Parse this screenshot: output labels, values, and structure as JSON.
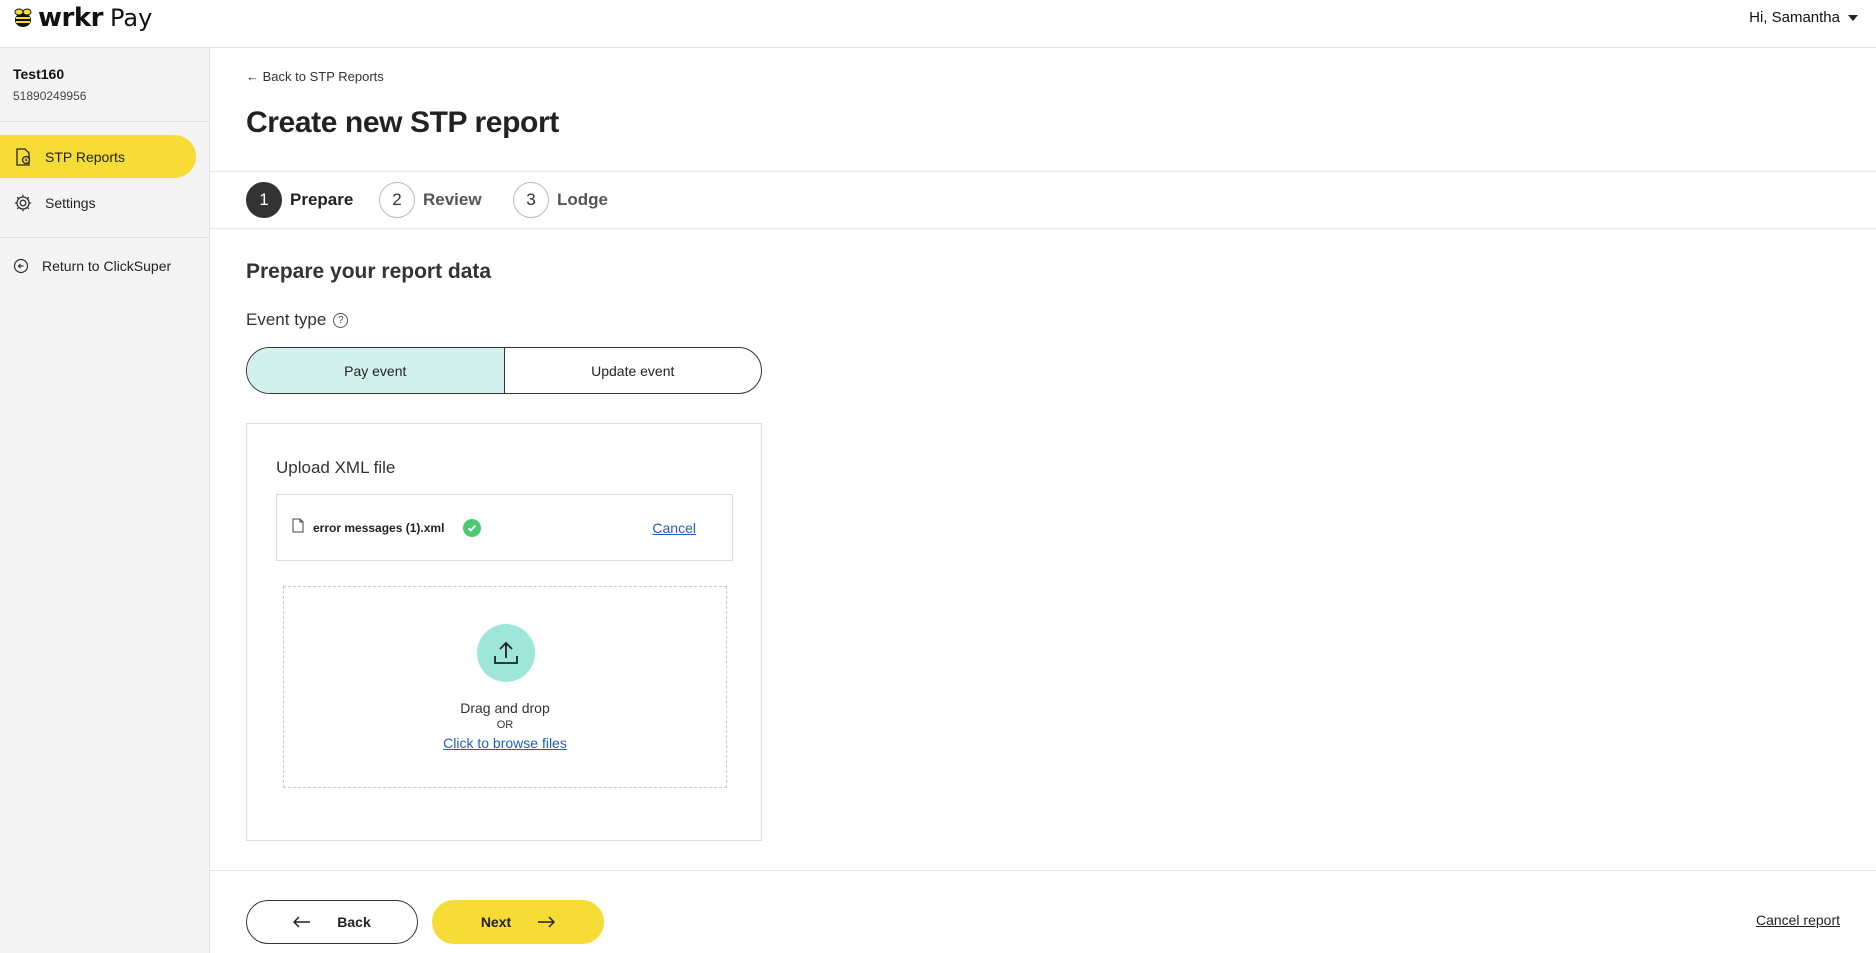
{
  "header": {
    "brand": "wrkr",
    "product": "Pay",
    "greeting": "Hi, Samantha"
  },
  "sidebar": {
    "org_name": "Test160",
    "org_number": "51890249956",
    "items": [
      {
        "label": "STP Reports",
        "icon": "stp-report-icon",
        "active": true
      },
      {
        "label": "Settings",
        "icon": "gear-icon",
        "active": false
      }
    ],
    "return_label": "Return to ClickSuper"
  },
  "main": {
    "back_link": "Back to STP Reports",
    "title": "Create new STP report",
    "steps": [
      {
        "number": "1",
        "label": "Prepare",
        "current": true
      },
      {
        "number": "2",
        "label": "Review",
        "current": false
      },
      {
        "number": "3",
        "label": "Lodge",
        "current": false
      }
    ],
    "section_title": "Prepare your report data",
    "event_type_label": "Event type",
    "event_options": [
      {
        "label": "Pay event",
        "selected": true
      },
      {
        "label": "Update event",
        "selected": false
      }
    ],
    "upload": {
      "title": "Upload XML file",
      "file_name": "error messages (1).xml",
      "cancel_label": "Cancel",
      "drag_text": "Drag and drop",
      "or_text": "OR",
      "browse_text": "Click to browse files"
    },
    "footer": {
      "back_label": "Back",
      "next_label": "Next",
      "cancel_report_label": "Cancel report"
    }
  },
  "colors": {
    "accent_yellow": "#f6dc34",
    "selected_teal": "#d3f2ee",
    "upload_teal": "#9fe6da",
    "success_green": "#4cc96e",
    "link_blue": "#1d5fb8"
  }
}
